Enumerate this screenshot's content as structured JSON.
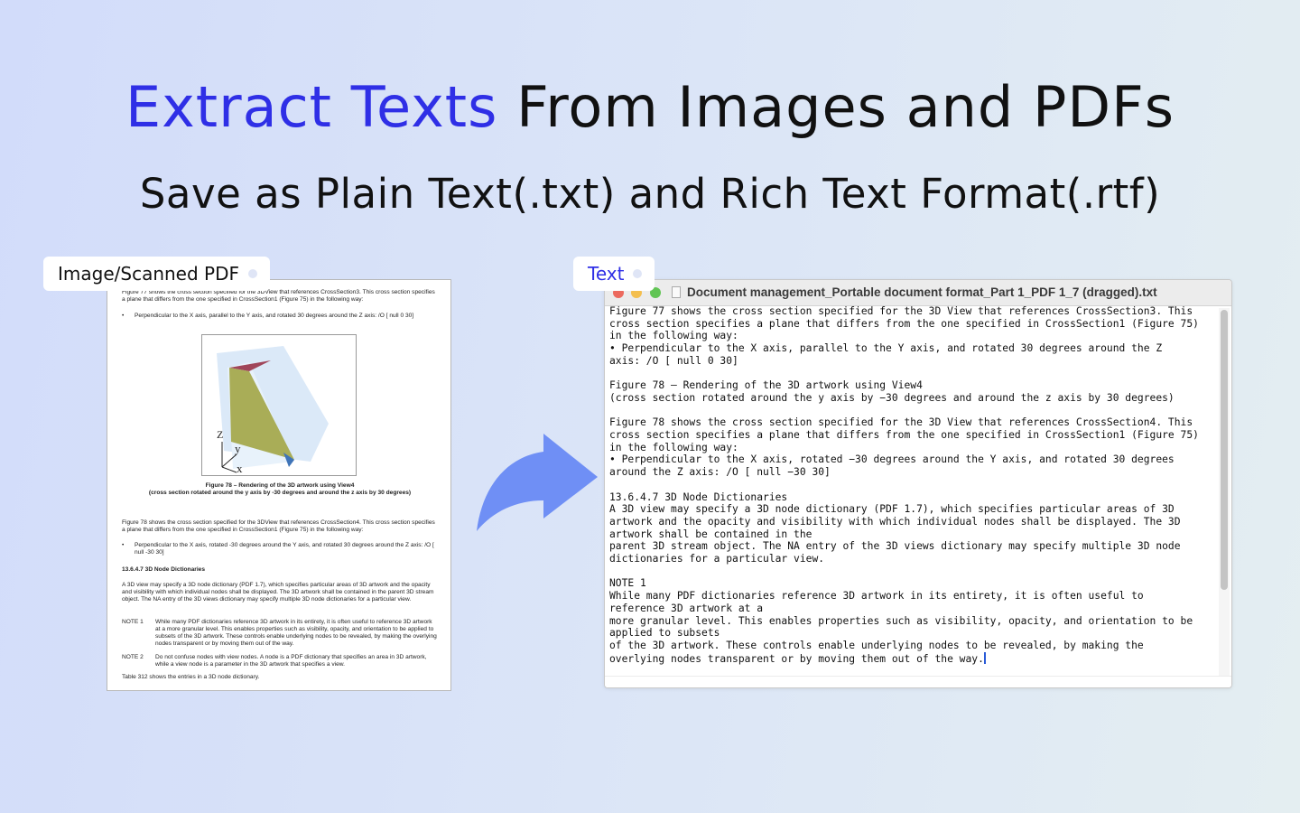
{
  "headline": {
    "highlight": "Extract Texts",
    "rest": " From Images and PDFs"
  },
  "subhead": "Save as Plain Text(.txt) and Rich Text Format(.rtf)",
  "tags": {
    "left": "Image/Scanned PDF",
    "right": "Text"
  },
  "pdf": {
    "p1": "Figure 77 shows the cross section specified for the 3DView that references CrossSection3. This cross section specifies a plane that differs from the one specified in CrossSection1 (Figure 75) in the following way:",
    "b1": "Perpendicular to the X axis, parallel to the Y axis, and rotated 30 degrees around the Z axis: /O [ null 0 30]",
    "axis_z": "Z",
    "axis_y": "y",
    "axis_x": "x",
    "caption1": "Figure 78 –  Rendering of the 3D artwork using View4",
    "caption2": "(cross section rotated around the y axis by -30 degrees and around the z axis by 30 degrees)",
    "p2": "Figure 78 shows the cross section specified for the 3DView that references CrossSection4. This cross section specifies a plane that differs from the one specified in CrossSection1 (Figure 75) in the following way:",
    "b2": "Perpendicular to the X axis, rotated -30 degrees around the Y axis, and rotated 30 degrees around the Z axis: /O [ null -30 30]",
    "heading": "13.6.4.7  3D Node Dictionaries",
    "p3": "A 3D view may specify a 3D node dictionary (PDF 1.7), which specifies particular areas of 3D artwork and the opacity and visibility with which individual nodes shall be displayed. The 3D artwork shall be contained in the parent 3D stream object. The NA entry of the 3D views dictionary may specify multiple 3D node dictionaries for a particular view.",
    "note1_label": "NOTE 1",
    "note1": "While many PDF dictionaries reference 3D artwork in its entirety, it is often useful to reference 3D artwork at a more granular level. This enables properties such as visibility, opacity, and orientation to be applied to subsets of the 3D artwork. These controls enable underlying nodes to be revealed, by making the overlying nodes transparent or by moving them out of the way.",
    "note2_label": "NOTE 2",
    "note2": "Do not confuse nodes with view nodes. A node is a PDF dictionary that specifies an area in 3D artwork, while a view node is a parameter in the 3D artwork that specifies a view.",
    "p4": "Table 312 shows the entries in a 3D node dictionary."
  },
  "editor": {
    "title": "Document management_Portable document format_Part 1_PDF 1_7 (dragged).txt",
    "text": "Figure 77 shows the cross section specified for the 3D View that references CrossSection3. This\ncross section specifies a plane that differs from the one specified in CrossSection1 (Figure 75)\nin the following way:\n• Perpendicular to the X axis, parallel to the Y axis, and rotated 30 degrees around the Z\naxis: /O [ null 0 30]\n\nFigure 78 — Rendering of the 3D artwork using View4\n(cross section rotated around the y axis by −30 degrees and around the z axis by 30 degrees)\n\nFigure 78 shows the cross section specified for the 3D View that references CrossSection4. This\ncross section specifies a plane that differs from the one specified in CrossSection1 (Figure 75)\nin the following way:\n• Perpendicular to the X axis, rotated −30 degrees around the Y axis, and rotated 30 degrees\naround the Z axis: /O [ null −30 30]\n\n13.6.4.7 3D Node Dictionaries\nA 3D view may specify a 3D node dictionary (PDF 1.7), which specifies particular areas of 3D\nartwork and the opacity and visibility with which individual nodes shall be displayed. The 3D\nartwork shall be contained in the\nparent 3D stream object. The NA entry of the 3D views dictionary may specify multiple 3D node\ndictionaries for a particular view.\n\nNOTE 1\nWhile many PDF dictionaries reference 3D artwork in its entirety, it is often useful to\nreference 3D artwork at a\nmore granular level. This enables properties such as visibility, opacity, and orientation to be\napplied to subsets\nof the 3D artwork. These controls enable underlying nodes to be revealed, by making the\noverlying nodes transparent or by moving them out of the way."
  },
  "colors": {
    "accent": "#2f2fe6",
    "arrow": "#6f8ff5"
  }
}
